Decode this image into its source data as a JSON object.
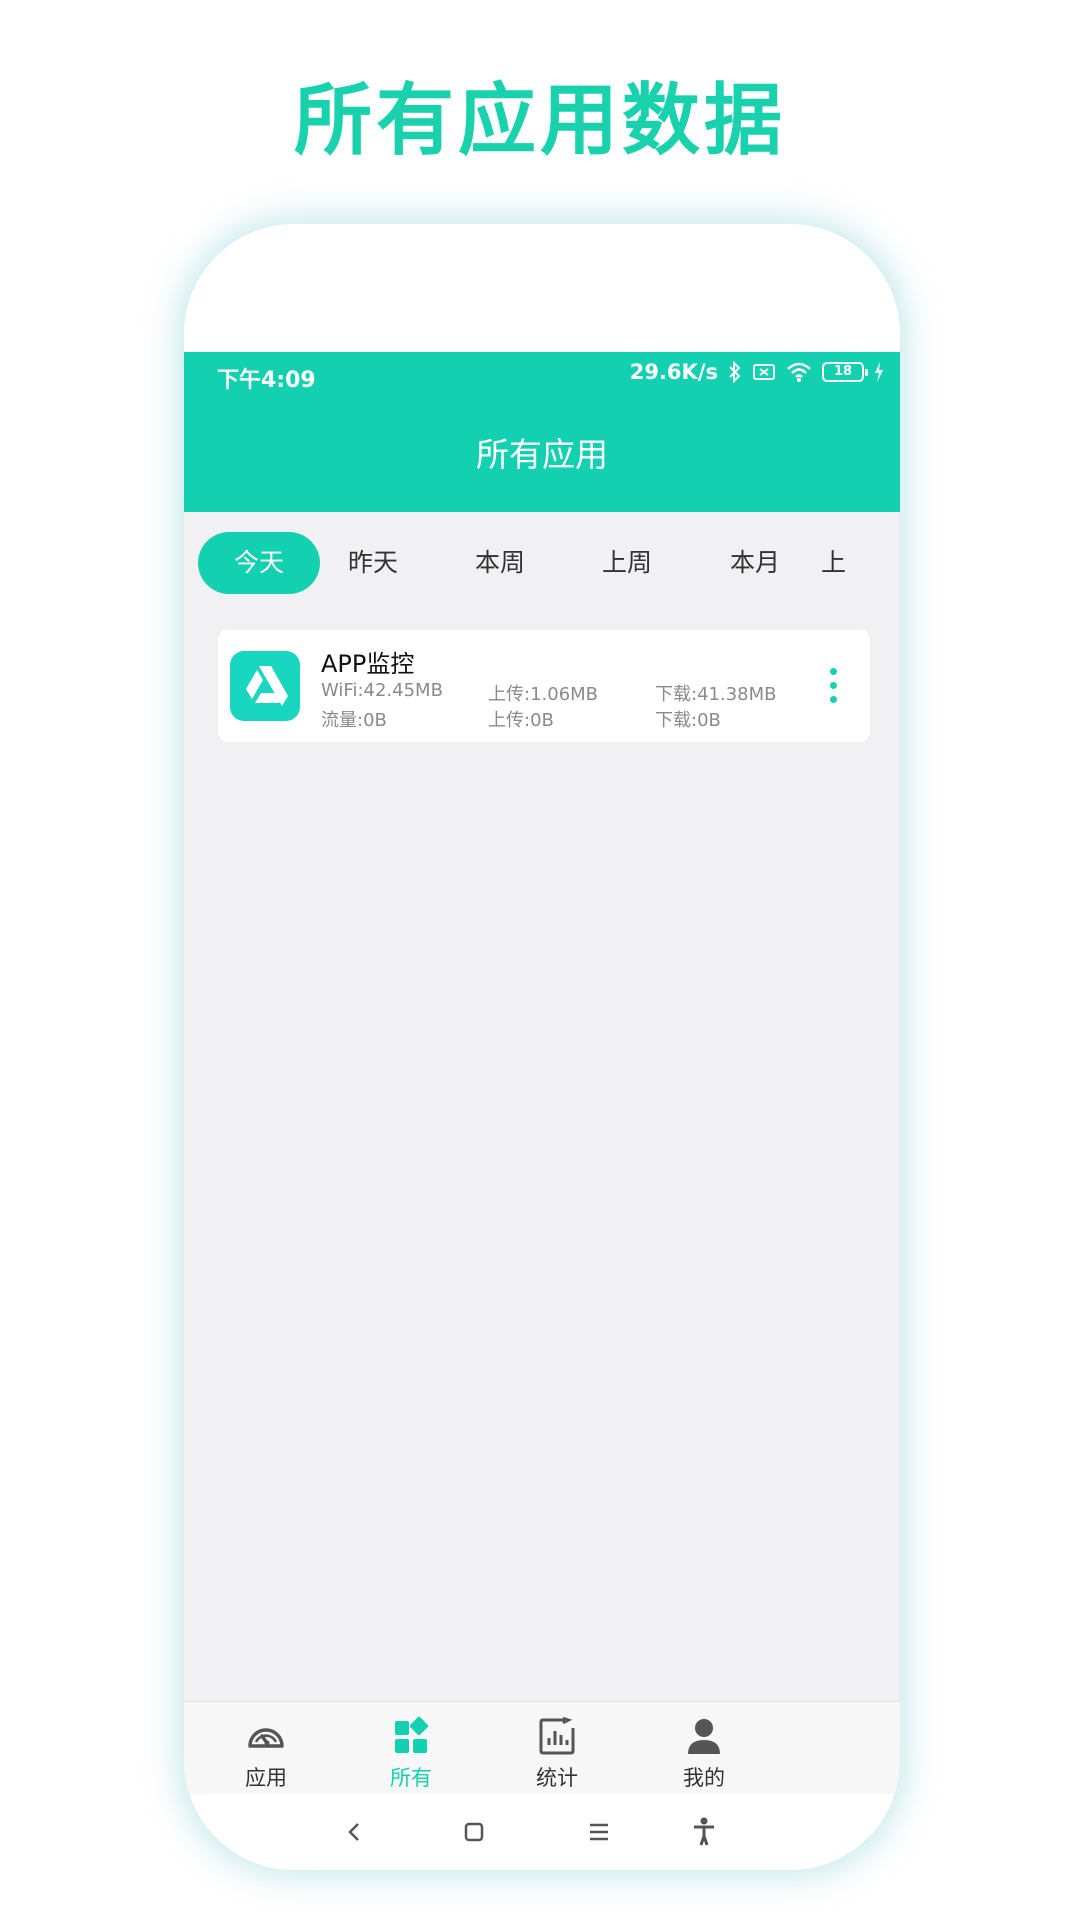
{
  "promo": {
    "title": "所有应用数据"
  },
  "status_bar": {
    "time": "下午4:09",
    "speed": "29.6K/s",
    "battery": "18"
  },
  "app_bar": {
    "title": "所有应用"
  },
  "tabs": [
    {
      "label": "今天",
      "active": true
    },
    {
      "label": "昨天"
    },
    {
      "label": "本周"
    },
    {
      "label": "上周"
    },
    {
      "label": "本月"
    },
    {
      "label": "上"
    }
  ],
  "app_list": [
    {
      "name": "APP监控",
      "wifi": "WiFi:42.45MB",
      "wifi_upload": "上传:1.06MB",
      "wifi_download": "下载:41.38MB",
      "mobile": "流量:0B",
      "mobile_upload": "上传:0B",
      "mobile_download": "下载:0B",
      "icon": "drive-triangle-icon",
      "color": "#19d6c0"
    }
  ],
  "bottom_nav": [
    {
      "label": "应用",
      "icon": "speedometer-icon"
    },
    {
      "label": "所有",
      "icon": "grid-apps-icon",
      "active": true
    },
    {
      "label": "统计",
      "icon": "bar-chart-icon"
    },
    {
      "label": "我的",
      "icon": "person-icon"
    }
  ],
  "colors": {
    "accent": "#13d1b0",
    "background": "#f1f1f3",
    "promo_text": "#19d1ac"
  }
}
